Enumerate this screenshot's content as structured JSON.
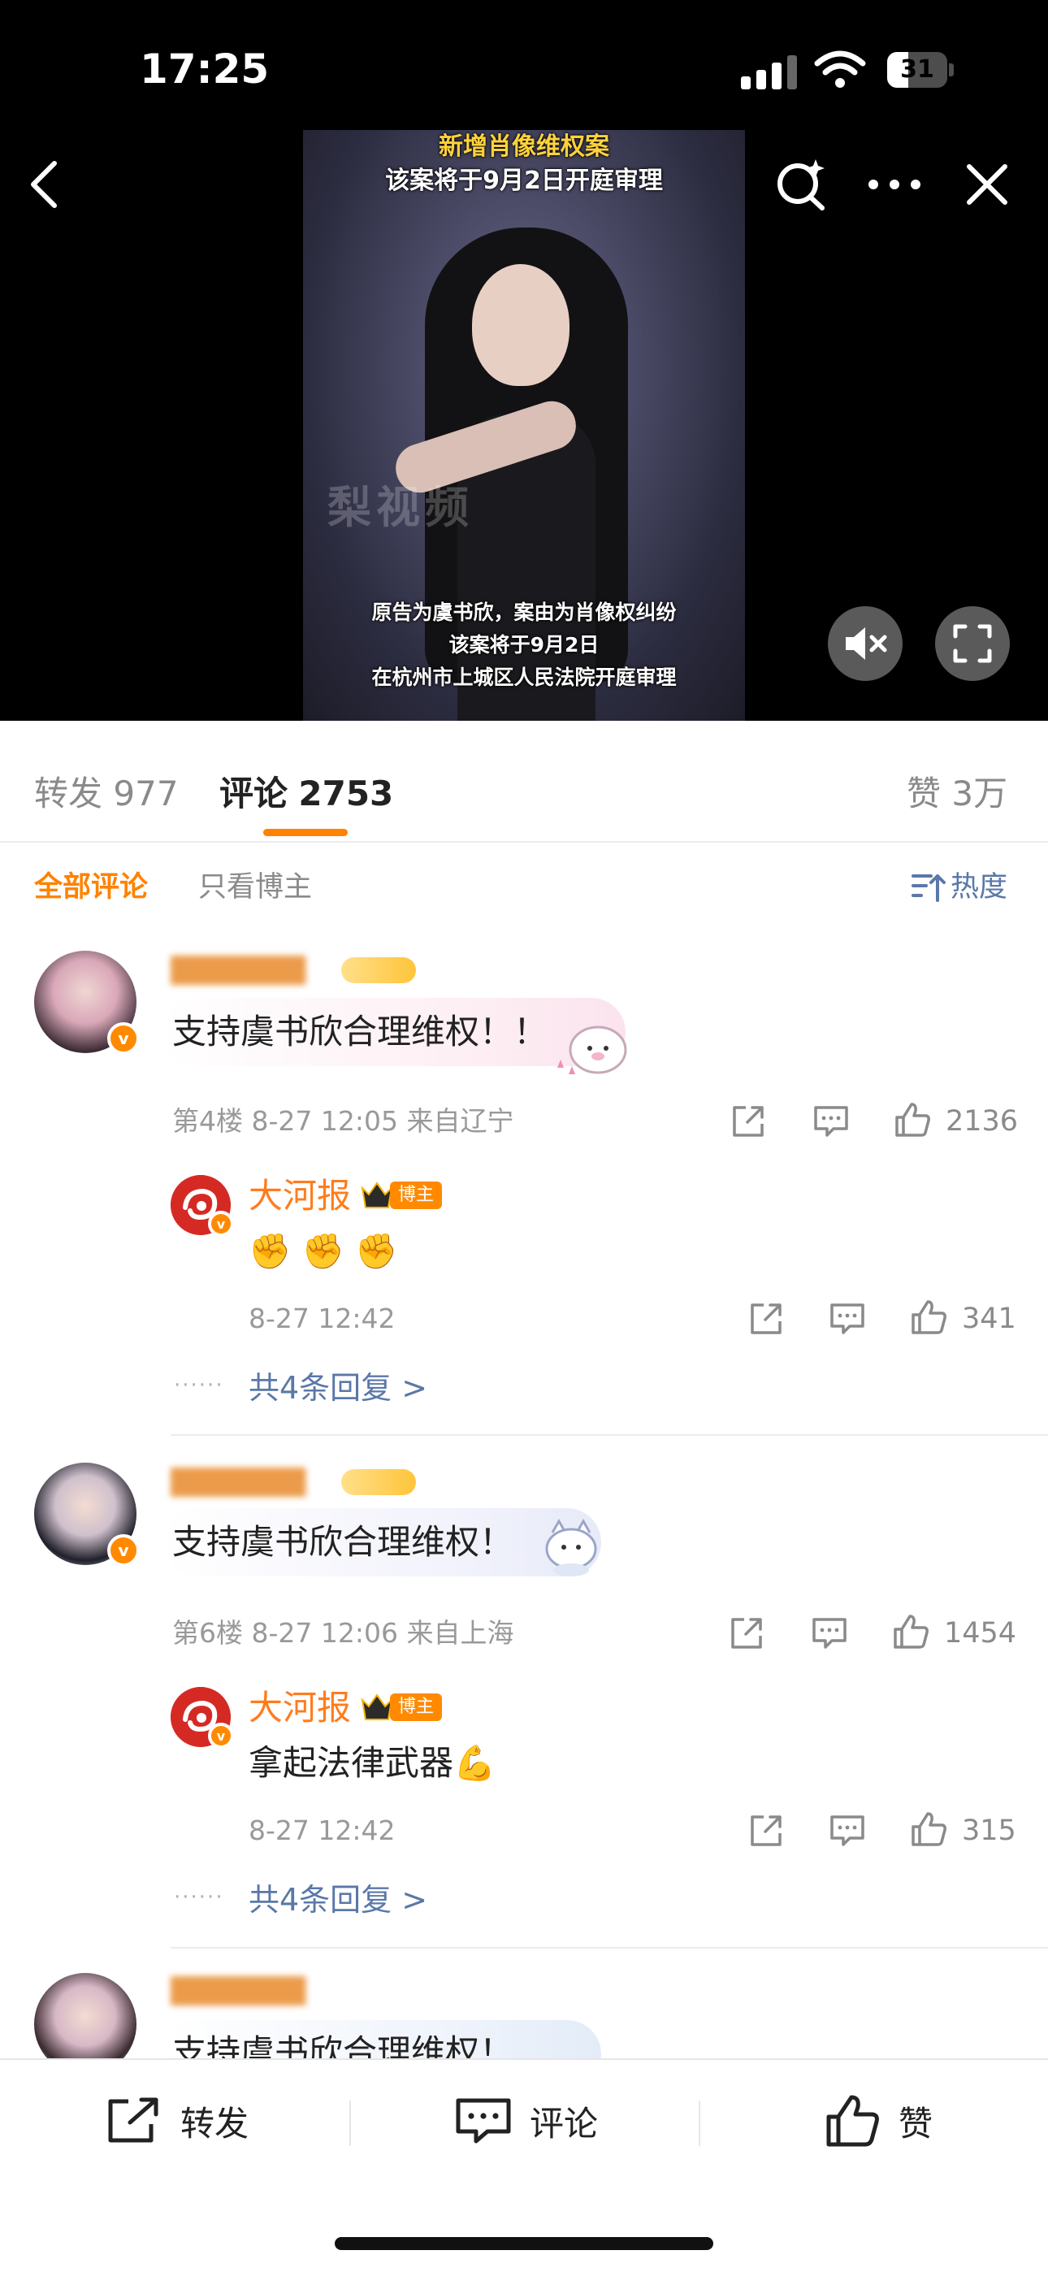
{
  "status_bar": {
    "time": "17:25",
    "battery": "31"
  },
  "video": {
    "caption_top_line1": "新增肖像维权案",
    "caption_top_line2": "该案将于9月2日开庭审理",
    "caption_bottom_line1": "原告为虞书欣，案由为肖像权纠纷",
    "caption_bottom_line2": "该案将于9月2日",
    "caption_bottom_line3": "在杭州市上城区人民法院开庭审理",
    "watermark": "梨视频"
  },
  "tabs": [
    {
      "label": "转发",
      "count": "977"
    },
    {
      "label": "评论",
      "count": "2753"
    },
    {
      "label": "赞",
      "count": "3万"
    }
  ],
  "filters": {
    "all": "全部评论",
    "blogger_only": "只看博主",
    "sort": "热度"
  },
  "comments": [
    {
      "text": "支持虞书欣合理维权！！",
      "meta": "第4楼 8-27 12:05 来自辽宁",
      "likes": "2136",
      "reply": {
        "name": "大河报",
        "badge": "博主",
        "text": "✊ ✊ ✊",
        "time": "8-27 12:42",
        "likes": "341"
      },
      "more_replies": "共4条回复 >"
    },
    {
      "text": "支持虞书欣合理维权！",
      "meta": "第6楼 8-27 12:06 来自上海",
      "likes": "1454",
      "reply": {
        "name": "大河报",
        "badge": "博主",
        "text": "拿起法律武器💪",
        "time": "8-27 12:42",
        "likes": "315"
      },
      "more_replies": "共4条回复 >"
    },
    {
      "text": "支持虞书欣合理维权！"
    }
  ],
  "bottom_bar": {
    "repost": "转发",
    "comment": "评论",
    "like": "赞"
  },
  "colors": {
    "accent": "#ff8200",
    "link": "#5a78a8",
    "blogger_name": "#ff7c1c"
  }
}
